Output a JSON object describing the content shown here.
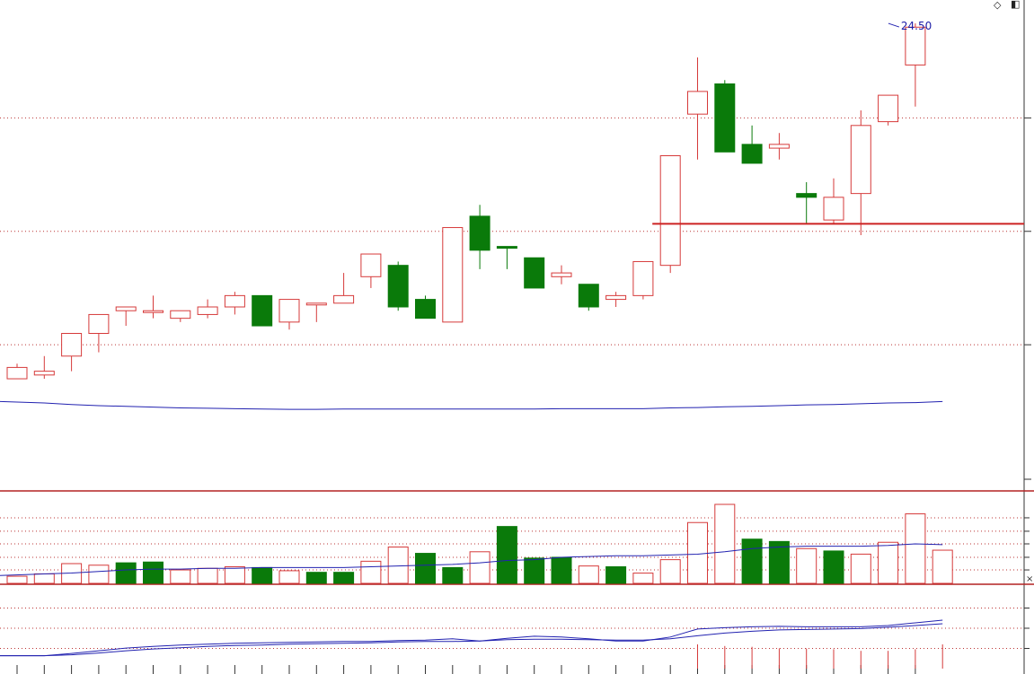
{
  "chart_data": [
    {
      "type": "candlestick",
      "panel": "price",
      "title": "",
      "xlabel": "",
      "ylabel": "",
      "ylim": [
        12.3,
        25.0
      ],
      "gridlines": [
        16.0,
        19.0,
        22.0
      ],
      "support_level": 19.2,
      "support_level_from_index": 24,
      "peak_label": "24.50",
      "peak_label_index": 33,
      "candles": [
        {
          "o": 15.4,
          "h": 15.5,
          "l": 15.1,
          "c": 15.1,
          "up": true
        },
        {
          "o": 15.2,
          "h": 15.7,
          "l": 15.1,
          "c": 15.3,
          "up": true
        },
        {
          "o": 15.7,
          "h": 16.0,
          "l": 15.3,
          "c": 16.3,
          "up": true
        },
        {
          "o": 16.3,
          "h": 16.8,
          "l": 15.8,
          "c": 16.8,
          "up": true
        },
        {
          "o": 16.9,
          "h": 17.0,
          "l": 16.5,
          "c": 17.0,
          "up": true
        },
        {
          "o": 16.9,
          "h": 17.3,
          "l": 16.7,
          "c": 16.9,
          "up": true
        },
        {
          "o": 16.7,
          "h": 16.9,
          "l": 16.6,
          "c": 16.9,
          "up": true
        },
        {
          "o": 16.8,
          "h": 17.2,
          "l": 16.7,
          "c": 17.0,
          "up": true
        },
        {
          "o": 17.0,
          "h": 17.4,
          "l": 16.8,
          "c": 17.3,
          "up": true
        },
        {
          "o": 17.3,
          "h": 17.0,
          "l": 16.5,
          "c": 16.5,
          "up": false
        },
        {
          "o": 16.6,
          "h": 17.2,
          "l": 16.4,
          "c": 17.2,
          "up": true
        },
        {
          "o": 17.1,
          "h": 17.1,
          "l": 16.6,
          "c": 17.1,
          "up": true
        },
        {
          "o": 17.1,
          "h": 17.9,
          "l": 17.1,
          "c": 17.3,
          "up": true
        },
        {
          "o": 17.8,
          "h": 18.3,
          "l": 17.5,
          "c": 18.4,
          "up": true
        },
        {
          "o": 18.1,
          "h": 18.2,
          "l": 16.9,
          "c": 17.0,
          "up": false
        },
        {
          "o": 17.2,
          "h": 17.3,
          "l": 16.7,
          "c": 16.7,
          "up": false
        },
        {
          "o": 16.6,
          "h": 19.1,
          "l": 16.6,
          "c": 19.1,
          "up": true
        },
        {
          "o": 19.4,
          "h": 19.7,
          "l": 18.0,
          "c": 18.5,
          "up": false
        },
        {
          "o": 18.6,
          "h": 18.6,
          "l": 18.0,
          "c": 18.6,
          "up": false
        },
        {
          "o": 18.3,
          "h": 18.3,
          "l": 17.5,
          "c": 17.5,
          "up": false
        },
        {
          "o": 17.9,
          "h": 18.1,
          "l": 17.6,
          "c": 17.8,
          "up": true
        },
        {
          "o": 17.6,
          "h": 17.3,
          "l": 16.9,
          "c": 17.0,
          "up": false
        },
        {
          "o": 17.2,
          "h": 17.4,
          "l": 17.0,
          "c": 17.3,
          "up": true
        },
        {
          "o": 17.3,
          "h": 18.2,
          "l": 17.2,
          "c": 18.2,
          "up": true
        },
        {
          "o": 18.1,
          "h": 20.7,
          "l": 17.9,
          "c": 21.0,
          "up": true
        },
        {
          "o": 22.1,
          "h": 23.6,
          "l": 20.9,
          "c": 22.7,
          "up": true
        },
        {
          "o": 22.9,
          "h": 23.0,
          "l": 21.1,
          "c": 21.1,
          "up": false
        },
        {
          "o": 21.3,
          "h": 21.8,
          "l": 20.8,
          "c": 20.8,
          "up": false
        },
        {
          "o": 21.2,
          "h": 21.6,
          "l": 20.9,
          "c": 21.3,
          "up": true
        },
        {
          "o": 20.0,
          "h": 20.3,
          "l": 19.2,
          "c": 19.9,
          "up": false
        },
        {
          "o": 19.3,
          "h": 20.4,
          "l": 19.2,
          "c": 19.9,
          "up": true
        },
        {
          "o": 20.0,
          "h": 22.2,
          "l": 18.9,
          "c": 21.8,
          "up": true
        },
        {
          "o": 21.9,
          "h": 22.6,
          "l": 21.8,
          "c": 22.6,
          "up": true
        },
        {
          "o": 23.4,
          "h": 24.5,
          "l": 22.3,
          "c": 24.4,
          "up": true
        }
      ],
      "ma_line": [
        14.5,
        14.46,
        14.42,
        14.39,
        14.37,
        14.35,
        14.33,
        14.32,
        14.31,
        14.3,
        14.29,
        14.29,
        14.3,
        14.3,
        14.3,
        14.3,
        14.3,
        14.3,
        14.3,
        14.3,
        14.31,
        14.31,
        14.31,
        14.31,
        14.33,
        14.34,
        14.36,
        14.37,
        14.39,
        14.41,
        14.42,
        14.44,
        14.46,
        14.47,
        14.5
      ]
    },
    {
      "type": "bar",
      "panel": "volume",
      "ylim": [
        0,
        100
      ],
      "gridlines": [
        17,
        33,
        50,
        66,
        83
      ],
      "values": [
        9,
        12,
        25,
        23,
        26,
        27,
        17,
        19,
        21,
        20,
        16,
        14,
        14,
        28,
        46,
        38,
        20,
        40,
        72,
        32,
        33,
        22,
        21,
        13,
        30,
        77,
        100,
        56,
        53,
        44,
        41,
        37,
        52,
        88,
        42
      ],
      "up": [
        true,
        true,
        true,
        true,
        false,
        false,
        true,
        true,
        true,
        false,
        true,
        false,
        false,
        true,
        true,
        false,
        false,
        true,
        false,
        false,
        false,
        true,
        false,
        true,
        true,
        true,
        true,
        false,
        false,
        true,
        false,
        true,
        true,
        true,
        true
      ],
      "ma": [
        10,
        12,
        13,
        15,
        17,
        18,
        18,
        19,
        19,
        20,
        20,
        20,
        20,
        21,
        22,
        23,
        24,
        26,
        29,
        30,
        33,
        34,
        35,
        35,
        36,
        37,
        40,
        44,
        46,
        47,
        47,
        47,
        48,
        50,
        49
      ]
    },
    {
      "type": "line",
      "panel": "indicator",
      "ylim": [
        0,
        100
      ],
      "series": [
        {
          "values": [
            20,
            20,
            25,
            31,
            37,
            41,
            44,
            46,
            48,
            49,
            50,
            51,
            52,
            52,
            54,
            55,
            58,
            53,
            59,
            64,
            62,
            58,
            53,
            53,
            62,
            80,
            83,
            85,
            86,
            85,
            85,
            85,
            88,
            94,
            112
          ]
        },
        {
          "values": [
            20,
            20,
            22,
            26,
            31,
            35,
            38,
            41,
            43,
            44,
            46,
            47,
            48,
            49,
            51,
            52,
            52,
            53,
            56,
            57,
            57,
            56,
            55,
            55,
            58,
            65,
            71,
            75,
            78,
            79,
            80,
            81,
            84,
            88,
            92
          ]
        }
      ],
      "bars": [
        0,
        0,
        0,
        0,
        0,
        0,
        0,
        0,
        0,
        0,
        0,
        0,
        0,
        0,
        0,
        0,
        0,
        0,
        0,
        0,
        0,
        0,
        0,
        0,
        0,
        30,
        28,
        27,
        25,
        25,
        24,
        22,
        22,
        24,
        30
      ]
    }
  ],
  "ui": {
    "diamond_icon": "diamond-icon",
    "window_icon": "window-toggle-icon"
  }
}
